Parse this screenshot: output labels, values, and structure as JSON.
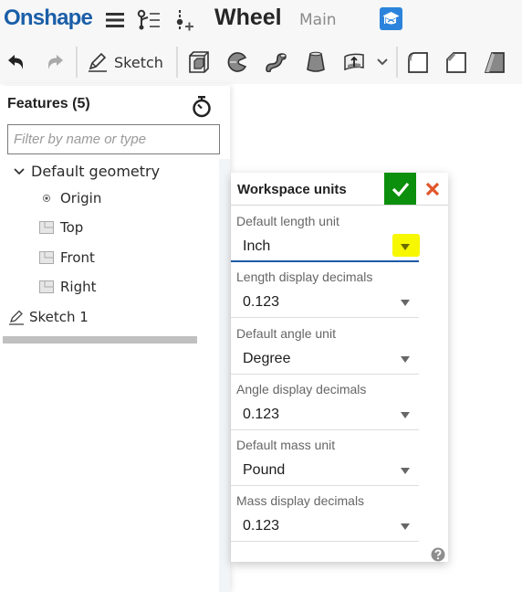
{
  "app": {
    "logo": "Onshape",
    "document_title": "Wheel",
    "branch": "Main",
    "colors": {
      "brand": "#1b5ea8",
      "learning_center": "#2c83dc",
      "accept": "#0c8f0c",
      "cancel": "#e0562a",
      "active_underline": "#1d5aa6",
      "highlight": "#f7f700"
    }
  },
  "topbar": {
    "icons": [
      "menu-icon",
      "version-graph-icon",
      "insert-icon",
      "learning-center-icon"
    ]
  },
  "toolbar": {
    "undo_icon": "undo-icon",
    "redo_icon": "redo-icon",
    "sketch_label": "Sketch",
    "tools": [
      "extrude-icon",
      "revolve-icon",
      "sweep-icon",
      "loft-icon",
      "thicken-icon",
      "fillet-icon",
      "chamfer-icon",
      "draft-icon"
    ]
  },
  "features": {
    "title": "Features (5)",
    "filter_placeholder": "Filter by name or type",
    "filter_value": "",
    "tree": {
      "group_label": "Default geometry",
      "items": [
        {
          "label": "Origin",
          "icon": "origin-icon"
        },
        {
          "label": "Top",
          "icon": "plane-icon"
        },
        {
          "label": "Front",
          "icon": "plane-icon"
        },
        {
          "label": "Right",
          "icon": "plane-icon"
        }
      ],
      "sketch": {
        "label": "Sketch 1",
        "icon": "sketch-icon"
      }
    }
  },
  "dialog": {
    "title": "Workspace units",
    "fields": [
      {
        "label": "Default length unit",
        "value": "Inch"
      },
      {
        "label": "Length display decimals",
        "value": "0.123"
      },
      {
        "label": "Default angle unit",
        "value": "Degree"
      },
      {
        "label": "Angle display decimals",
        "value": "0.123"
      },
      {
        "label": "Default mass unit",
        "value": "Pound"
      },
      {
        "label": "Mass display decimals",
        "value": "0.123"
      }
    ]
  }
}
